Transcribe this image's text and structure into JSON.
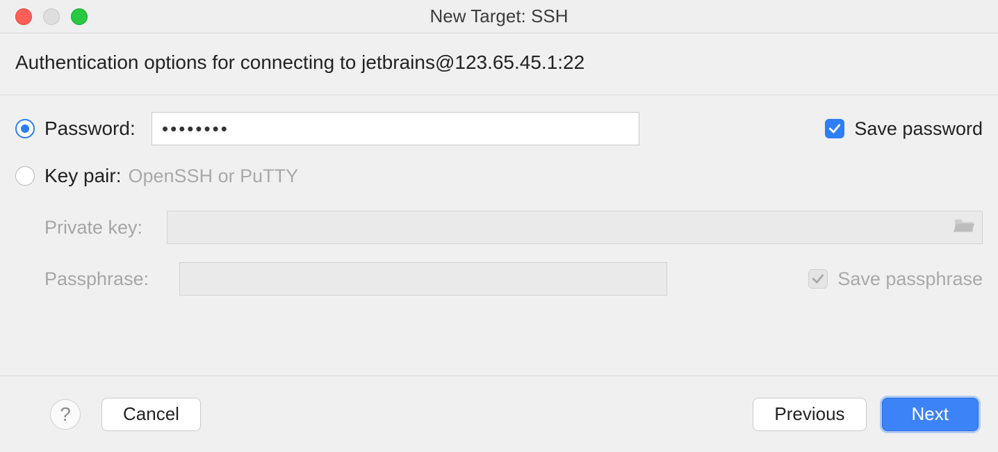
{
  "header": {
    "title": "New Target: SSH"
  },
  "subtitle": "Authentication options for connecting to jetbrains@123.65.45.1:22",
  "auth": {
    "password": {
      "radio_label": "Password:",
      "value": "••••••••",
      "save_label": "Save password",
      "save_checked": true,
      "selected": true
    },
    "keypair": {
      "radio_label": "Key pair:",
      "hint": "OpenSSH or PuTTY",
      "selected": false,
      "private_key": {
        "label": "Private key:",
        "value": ""
      },
      "passphrase": {
        "label": "Passphrase:",
        "value": "",
        "save_label": "Save passphrase",
        "save_checked": true
      }
    }
  },
  "footer": {
    "help": "?",
    "cancel": "Cancel",
    "previous": "Previous",
    "next": "Next"
  }
}
